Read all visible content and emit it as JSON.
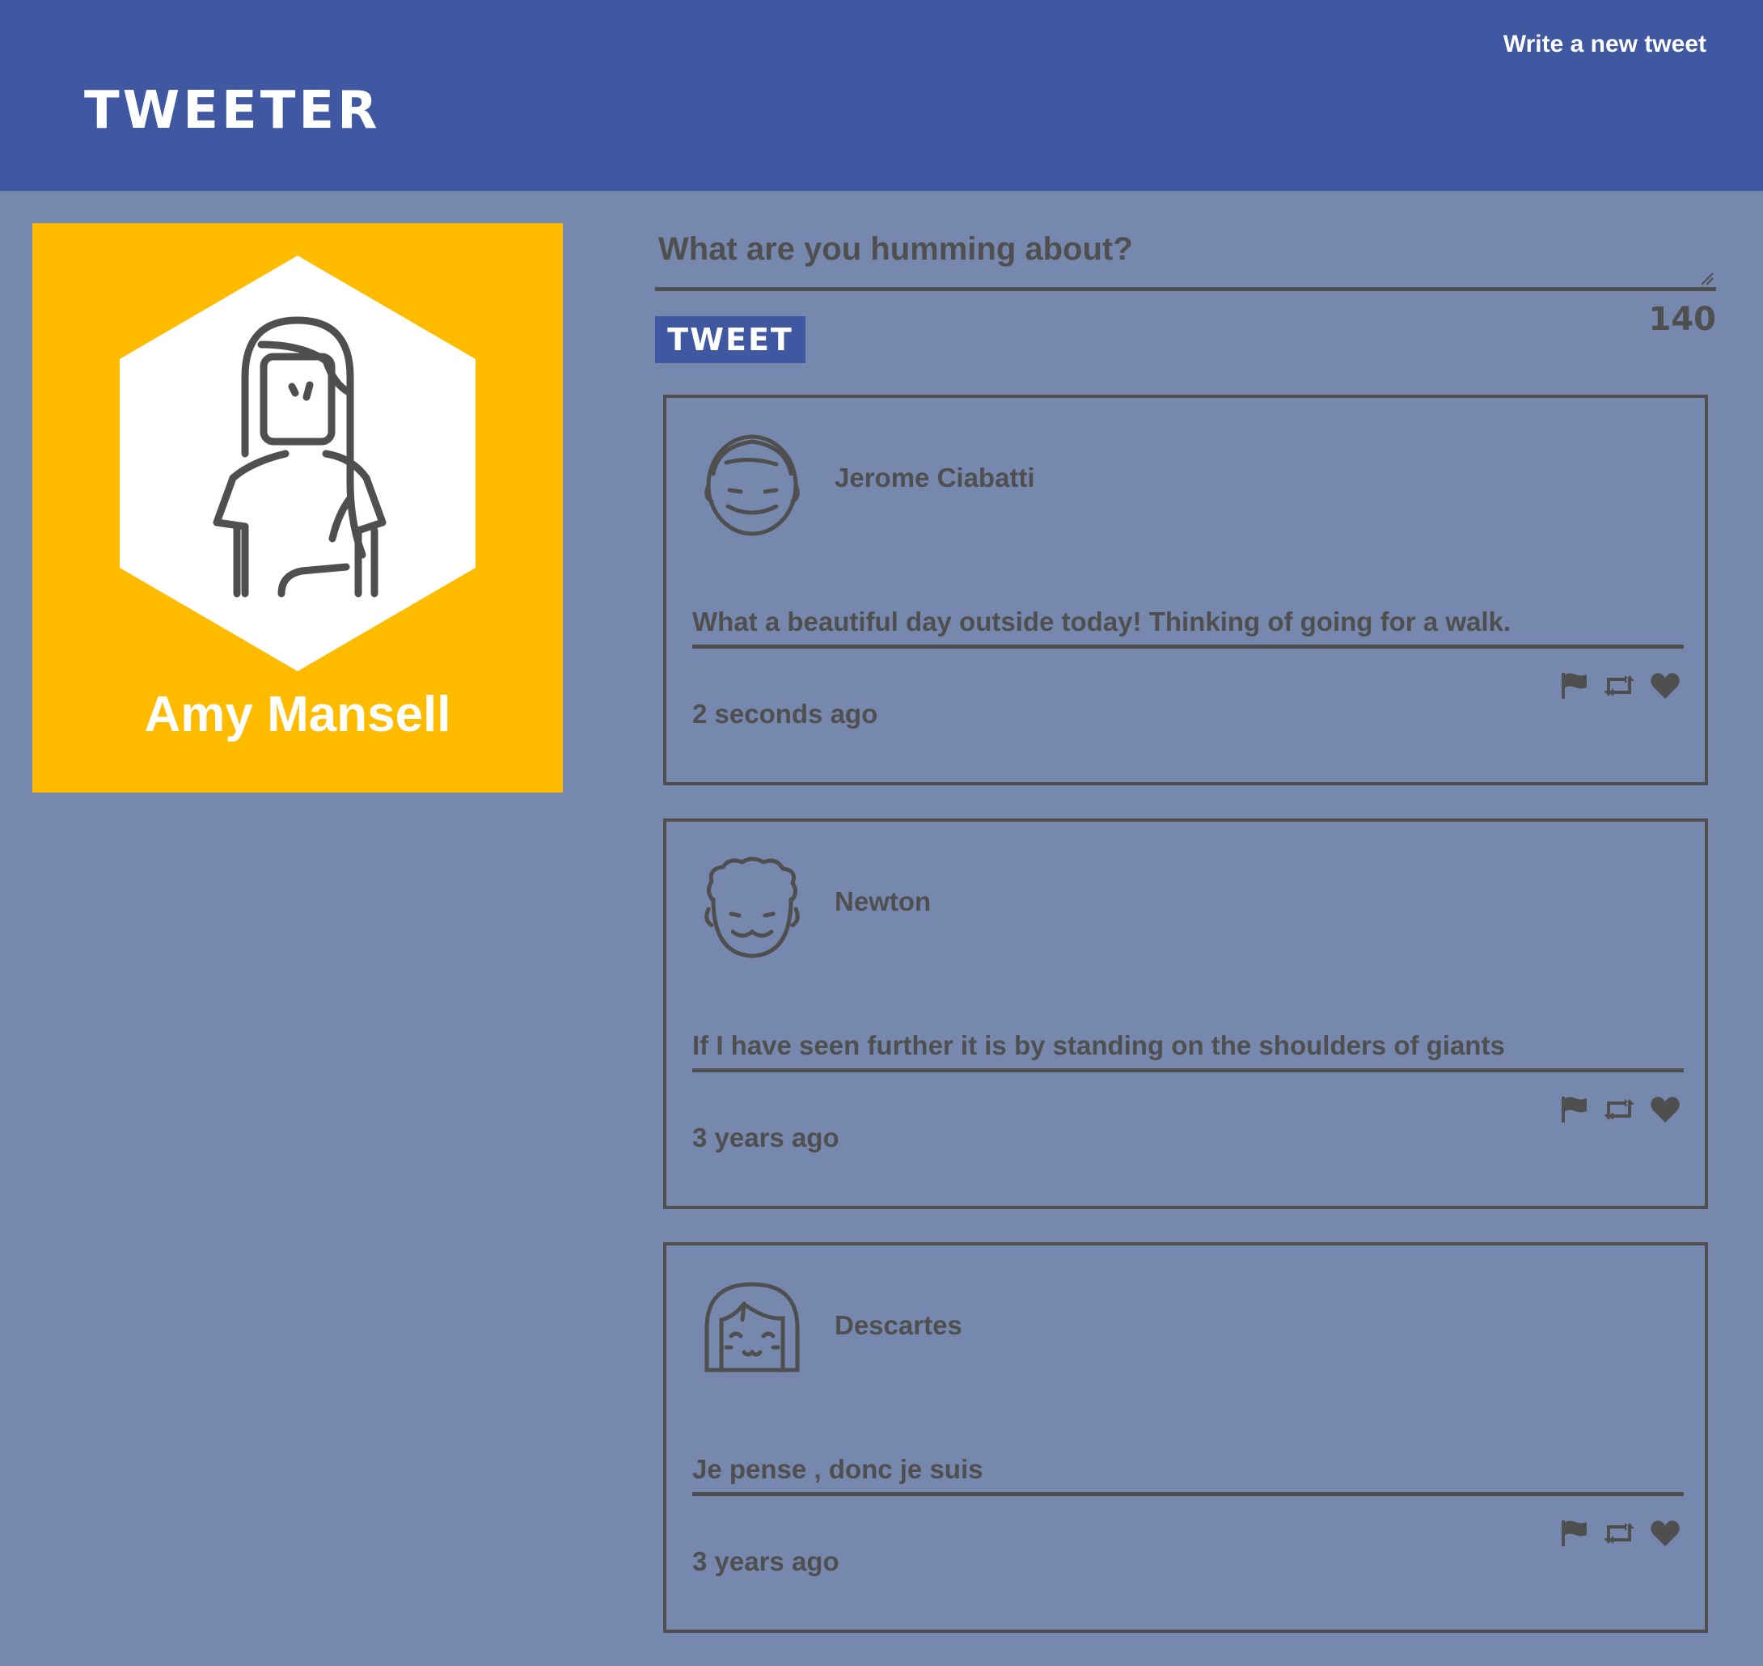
{
  "header": {
    "logo": "TWEETER",
    "compose_link": "Write a new tweet"
  },
  "profile": {
    "name": "Amy Mansell",
    "avatar_icon": "woman-avatar-icon",
    "card_color": "#ffbb00"
  },
  "compose": {
    "placeholder": "What are you humming about?",
    "button_label": "TWEET",
    "char_count": "140"
  },
  "tweets": [
    {
      "name": "Jerome Ciabatti",
      "text": "What a beautiful day outside today! Thinking of going for a walk.",
      "time": "2 seconds ago",
      "avatar_icon": "smiling-man-avatar-icon"
    },
    {
      "name": "Newton",
      "text": "If I have seen further it is by standing on the shoulders of giants",
      "time": "3 years ago",
      "avatar_icon": "curly-hair-man-avatar-icon"
    },
    {
      "name": "Descartes",
      "text": "Je pense , donc je suis",
      "time": "3 years ago",
      "avatar_icon": "bob-hair-avatar-icon"
    }
  ],
  "actions": [
    "flag-icon",
    "retweet-icon",
    "heart-icon"
  ],
  "colors": {
    "header": "#4057a1",
    "background": "#7788ae",
    "text": "#4f4f4f",
    "accent": "#ffbb00"
  }
}
